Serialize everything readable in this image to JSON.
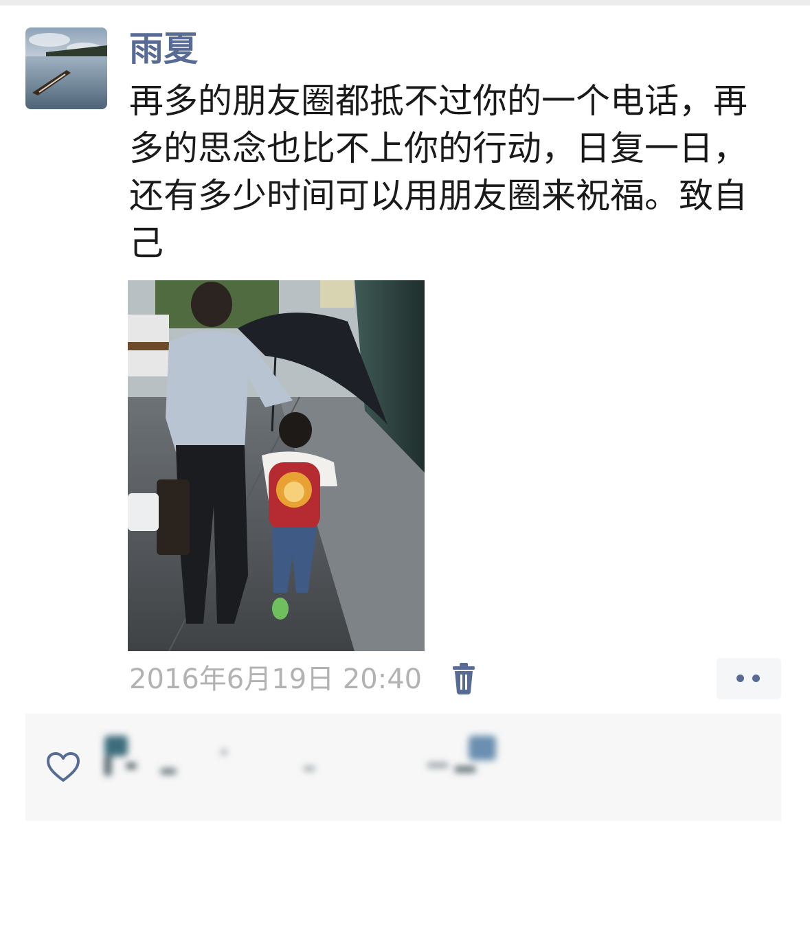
{
  "post": {
    "author": "雨夏",
    "text": "再多的朋友圈都抵不过你的一个电话，再多的思念也比不上你的行动，日复一日，还有多少时间可以用朋友圈来祝福。致自己",
    "timestamp": "2016年6月19日 20:40"
  },
  "icons": {
    "delete": "trash-icon",
    "more": "more-dots-icon",
    "like": "heart-icon"
  },
  "likes": {
    "names": ""
  },
  "colors": {
    "username": "#576b95",
    "body_text": "#1a1a1a",
    "timestamp": "#b2b2b2",
    "likes_bg": "#f7f7f7"
  }
}
